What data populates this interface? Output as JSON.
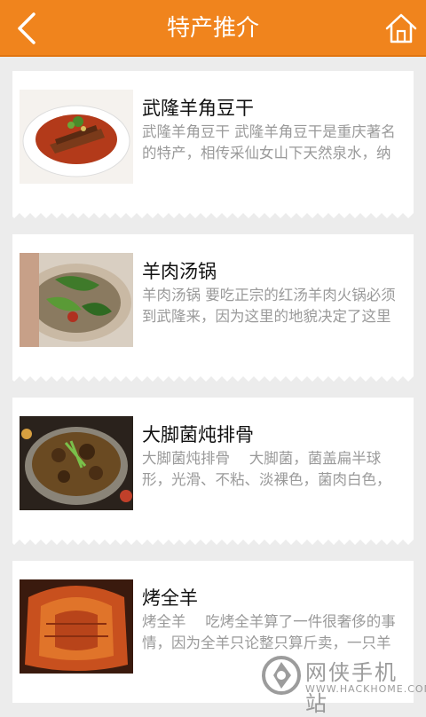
{
  "header": {
    "title": "特产推介",
    "back_icon": "back-arrow-icon",
    "home_icon": "home-icon",
    "bg_color": "#f0841d"
  },
  "items": [
    {
      "title": "武隆羊角豆干",
      "desc": "武隆羊角豆干 武隆羊角豆干是重庆著名的特产，相传采仙女山下天然泉水，纳"
    },
    {
      "title": "羊肉汤锅",
      "desc": "羊肉汤锅 要吃正宗的红汤羊肉火锅必须到武隆来，因为这里的地貌决定了这里"
    },
    {
      "title": "大脚菌炖排骨",
      "desc": "大脚菌炖排骨　 大脚菌，菌盖扁半球形，光滑、不粘、淡裸色，菌肉白色，"
    },
    {
      "title": "烤全羊",
      "desc": "烤全羊　 吃烤全羊算了一件很奢侈的事情，因为全羊只论整只算斤卖，一只羊"
    }
  ],
  "watermark": {
    "text": "网侠手机站",
    "url": "WWW.HACKHOME.COM"
  }
}
